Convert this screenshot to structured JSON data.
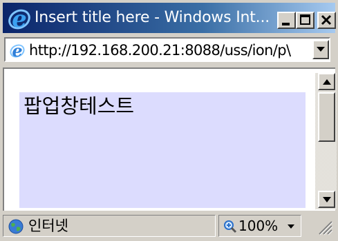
{
  "window": {
    "title": "Insert title here - Windows Int...",
    "icon": "ie-logo-icon",
    "controls": [
      "minimize-icon",
      "maximize-icon",
      "close-icon"
    ]
  },
  "address_bar": {
    "url": "http://192.168.200.21:8088/uss/ion/p\\",
    "icon": "ie-page-icon"
  },
  "page": {
    "text": "팝업창테스트",
    "background": "#dcdcfe"
  },
  "status_bar": {
    "zone": "인터넷",
    "zoom": "100%"
  },
  "colors": {
    "titlebar_start": "#0a246a",
    "titlebar_end": "#a6caf0",
    "chrome": "#d4d0c8"
  }
}
